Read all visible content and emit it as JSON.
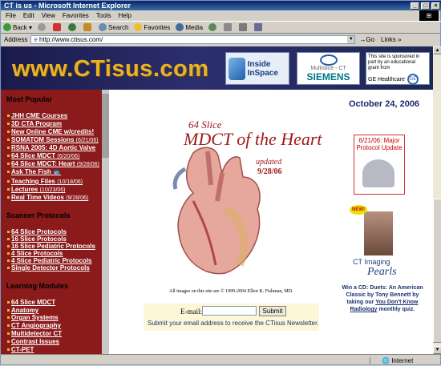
{
  "window": {
    "title": "CT is us - Microsoft Internet Explorer"
  },
  "menu": [
    "File",
    "Edit",
    "View",
    "Favorites",
    "Tools",
    "Help"
  ],
  "toolbar": {
    "back": "Back",
    "search": "Search",
    "favorites": "Favorites",
    "media": "Media"
  },
  "address": {
    "label": "Address",
    "url": "http://www.ctisus.com/",
    "go": "Go",
    "links": "Links"
  },
  "banner": {
    "logo": "www.CTisus.com",
    "inside": "Inside InSpace",
    "siemens_small": "Multislice - CT",
    "siemens": "SIEMENS",
    "ge_text": "This site is sponsored in part by an educational grant from",
    "ge": "GE Healthcare"
  },
  "sidebar": {
    "popular_title": "Most Popular",
    "popular": [
      {
        "label": "JHH CME Courses",
        "date": ""
      },
      {
        "label": "3D CTA Program",
        "date": ""
      },
      {
        "label": "New Online CME w/credits!",
        "date": ""
      },
      {
        "label": "SOMATOM Sessions",
        "date": "(6/21/06)"
      },
      {
        "label": "RSNA 2005: 4D Aortic Valve",
        "date": ""
      },
      {
        "label": "64 Slice MDCT",
        "date": "(6/20/06)"
      },
      {
        "label": "64 Slice MDCT: Heart",
        "date": "(9/28/06)"
      },
      {
        "label": "Ask The Fish",
        "date": ""
      },
      {
        "label": "Teaching Files",
        "date": "(10/18/06)"
      },
      {
        "label": "Lectures",
        "date": "(10/23/06)"
      },
      {
        "label": "Real Time Videos",
        "date": "(9/28/06)"
      }
    ],
    "scanner_title": "Scanner Protocols",
    "scanner": [
      "64 Slice Protocols",
      "16 Slice Protocols",
      "16 Slice Pediatric Protocols",
      "4 Slice Protocols",
      "4 Slice Pediatric Protocols",
      "Single Detector Protocols"
    ],
    "modules_title": "Learning Modules",
    "modules": [
      "64 Slice MDCT",
      "Anatomy",
      "Organ Systems",
      "CT Angiography",
      "Multidetector CT",
      "Contrast Issues",
      "CT-PET"
    ]
  },
  "main": {
    "date": "October 24, 2006",
    "hero_l1": "64 Slice",
    "hero_l2": "MDCT of the Heart",
    "hero_l3": "updated",
    "hero_l4": "9/28/06",
    "copyright": "All images on this site are © 1999-2004 Elliot K. Fishman, MD.",
    "email_label": "E-mail:",
    "submit": "Submit",
    "newsletter_msg": "Submit your email address to receive the CTisus Newsletter.",
    "protocol_title": "6/21/06: Major Protocol Update",
    "new_badge": "NEW!",
    "pearls_1": "CT Imaging",
    "pearls_2": "Pearls",
    "quiz_1": "Win a CD: Duets: An American Classic by Tony Bennett by taking our",
    "quiz_link": "You Don't Know Radiology",
    "quiz_2": "monthly quiz."
  },
  "status": {
    "text": "",
    "zone": "Internet"
  }
}
